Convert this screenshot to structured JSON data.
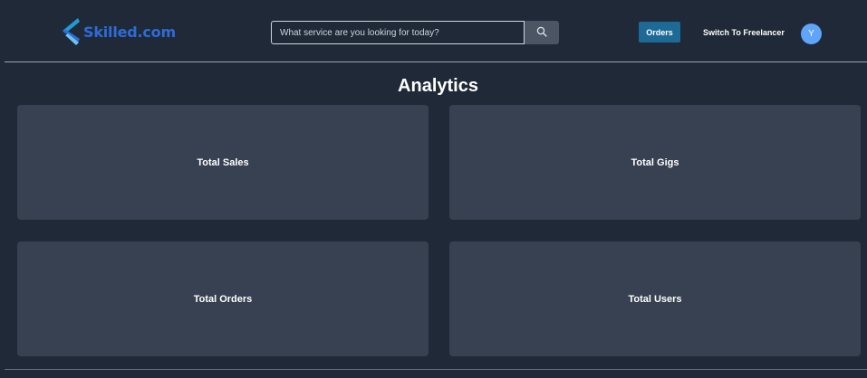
{
  "header": {
    "logo_text": "Skilled.com",
    "search_placeholder": "What service are you looking for today?",
    "search_icon": "search-icon",
    "orders_label": "Orders",
    "switch_label": "Switch To Freelancer",
    "avatar_initial": "Y"
  },
  "main": {
    "title": "Analytics",
    "cards": [
      {
        "label": "Total Sales"
      },
      {
        "label": "Total Gigs"
      },
      {
        "label": "Total Orders"
      },
      {
        "label": "Total Users"
      }
    ]
  },
  "colors": {
    "background": "#1f2937",
    "card": "#374151",
    "brand_blue": "#2f6bd8",
    "orders_button": "#1e6a97",
    "avatar": "#60a5fa"
  }
}
